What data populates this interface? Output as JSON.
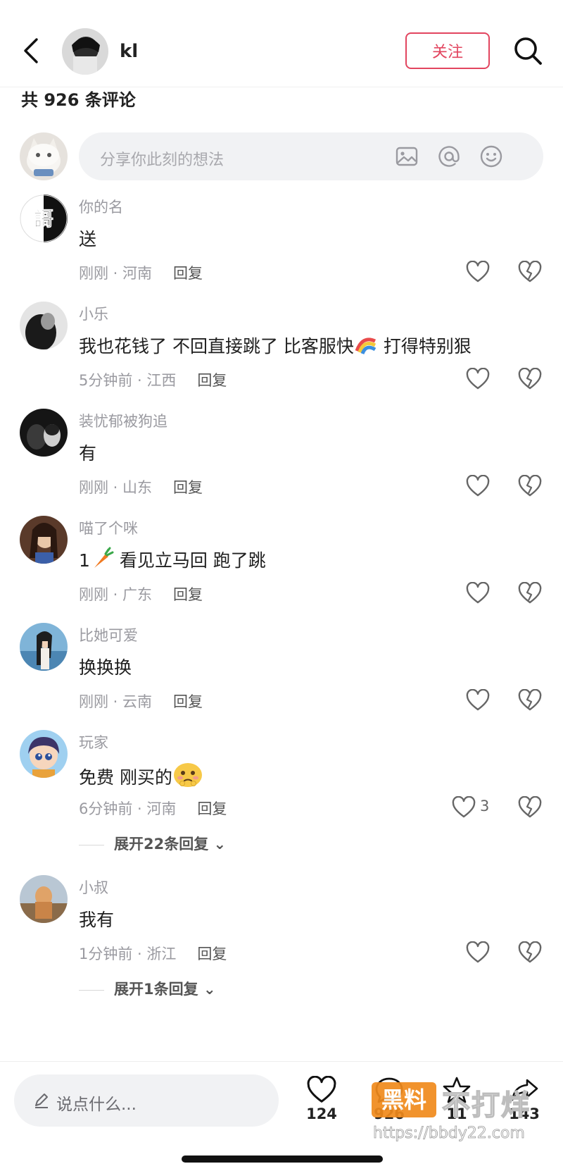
{
  "header": {
    "username": "kl",
    "follow_label": "关注"
  },
  "comment_count_text": "共 926 条评论",
  "compose": {
    "placeholder": "分享你此刻的想法"
  },
  "comments": [
    {
      "user": "你的名",
      "text": "送",
      "time": "刚刚",
      "location": "河南",
      "reply_label": "回复"
    },
    {
      "user": "小乐",
      "text_before_emoji": "我也花钱了 不回直接跳了 比客服快",
      "emoji": "rainbow-emoji",
      "text_after_emoji": " 打得特别狠",
      "time": "5分钟前",
      "location": "江西",
      "reply_label": "回复"
    },
    {
      "user": "装忧郁被狗追",
      "text": "有",
      "time": "刚刚",
      "location": "山东",
      "reply_label": "回复"
    },
    {
      "user": "喵了个咪",
      "text_before_emoji": "1",
      "emoji": "carrot-emoji",
      "text_after_emoji": " 看见立马回 跑了跳",
      "time": "刚刚",
      "location": "广东",
      "reply_label": "回复"
    },
    {
      "user": "比她可爱",
      "text": "换换换",
      "time": "刚刚",
      "location": "云南",
      "reply_label": "回复"
    },
    {
      "user": "玩家",
      "text_before_emoji": "免费 刚买的",
      "emoji": "blushing-face-emoji",
      "text_after_emoji": "",
      "time": "6分钟前",
      "location": "河南",
      "reply_label": "回复",
      "likes": "3",
      "expand_label": "展开22条回复"
    },
    {
      "user": "小叔",
      "text": "我有",
      "time": "1分钟前",
      "location": "浙江",
      "reply_label": "回复",
      "expand_label": "展开1条回复"
    }
  ],
  "bottom_bar": {
    "input_placeholder": "说点什么...",
    "like_count": "124",
    "comment_count": "926",
    "star_count": "11",
    "share_count": "143"
  },
  "watermark": {
    "badge": "黑料",
    "text": "不打烊",
    "url": "https://bbdy22.com"
  },
  "colors": {
    "accent": "#e2455f",
    "muted": "#9a9aa0",
    "input_bg": "#f1f2f4"
  }
}
